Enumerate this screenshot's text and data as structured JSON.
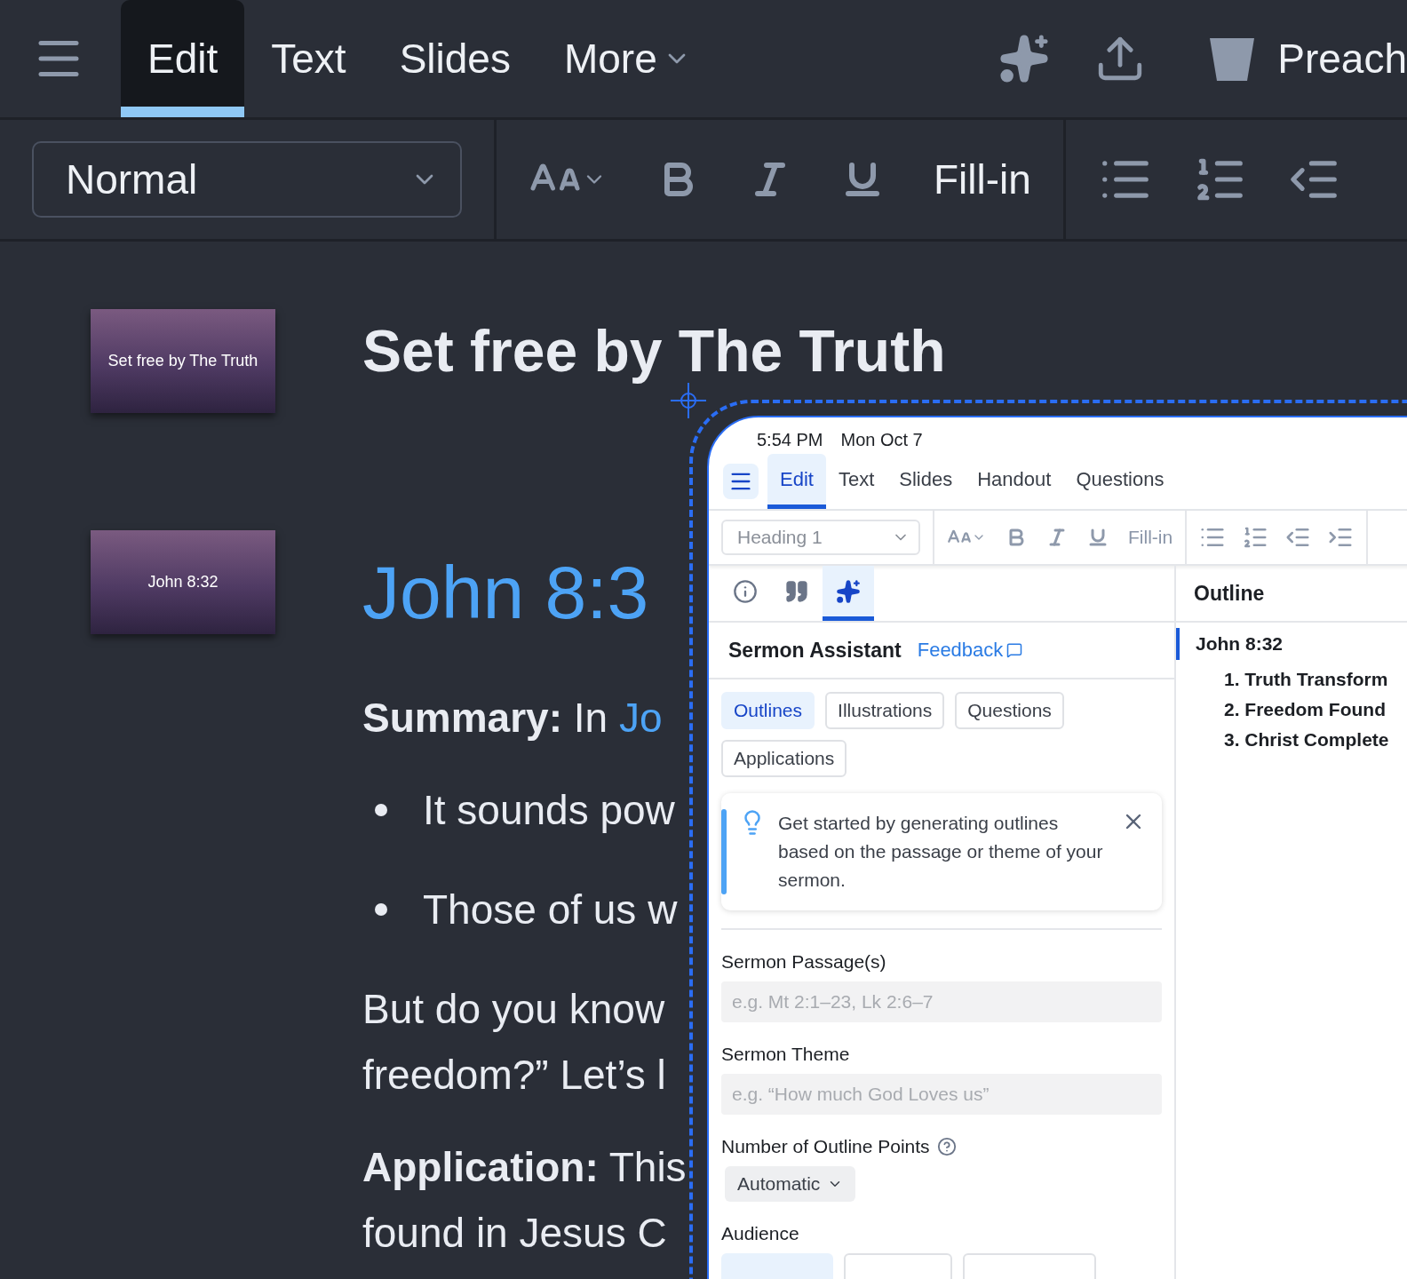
{
  "app_bar": {
    "tabs": [
      {
        "label": "Edit",
        "selected": true
      },
      {
        "label": "Text",
        "selected": false
      },
      {
        "label": "Slides",
        "selected": false
      },
      {
        "label": "More",
        "selected": false,
        "kind": "menu"
      }
    ],
    "account_label": "Preach"
  },
  "format_bar": {
    "style": "Normal",
    "fill_in": "Fill-in"
  },
  "slides": [
    {
      "caption": "Set free by The Truth"
    },
    {
      "caption": "John 8:32"
    }
  ],
  "document": {
    "title": "Set free by The Truth",
    "heading": "John 8:3",
    "blocks": [
      {
        "kind": "labeled",
        "label": "Summary:",
        "text": "In",
        "link": "Jo"
      },
      {
        "kind": "bullet",
        "text": "It sounds pow"
      },
      {
        "kind": "bullet",
        "text": "Those of us w"
      },
      {
        "kind": "paragraph",
        "lines": [
          "But do you know",
          "freedom?” Let’s l"
        ]
      },
      {
        "kind": "labeled",
        "label": "Application:",
        "text": "This",
        "lines": [
          "found in Jesus C"
        ]
      }
    ]
  },
  "inset": {
    "status_time": "5:54 PM",
    "status_date": "Mon Oct 7",
    "tabs": [
      {
        "label": "Edit",
        "selected": true
      },
      {
        "label": "Text",
        "selected": false
      },
      {
        "label": "Slides",
        "selected": false
      },
      {
        "label": "Handout",
        "selected": false
      },
      {
        "label": "Questions",
        "selected": false
      }
    ],
    "style": "Heading 1",
    "fill_in": "Fill-in",
    "panel_tabs": [
      {
        "kind": "info",
        "selected": false
      },
      {
        "kind": "quote",
        "selected": false
      },
      {
        "kind": "sparkle",
        "selected": true
      }
    ],
    "assistant_title": "Sermon Assistant",
    "feedback": "Feedback",
    "modes": [
      {
        "label": "Outlines",
        "selected": true
      },
      {
        "label": "Illustrations",
        "selected": false
      },
      {
        "label": "Questions",
        "selected": false
      },
      {
        "label": "Applications",
        "selected": false
      }
    ],
    "tip": "Get started by generating outlines based on the passage or theme of your sermon.",
    "fields": [
      {
        "label": "Sermon Passage(s)",
        "placeholder": "e.g. Mt 2:1–23, Lk 2:6–7"
      },
      {
        "label": "Sermon Theme",
        "placeholder": "e.g. “How much God Loves us”"
      }
    ],
    "points": {
      "label": "Number of Outline Points",
      "value": "Automatic"
    },
    "audience": {
      "label": "Audience",
      "options": [
        {
          "selected": true
        },
        {
          "selected": false
        },
        {
          "selected": false
        }
      ]
    },
    "outline": {
      "title": "Outline",
      "items": [
        {
          "label": "John 8:32",
          "selected": true,
          "children": [
            {
              "label": "1. Truth Transform"
            },
            {
              "label": "2. Freedom Found"
            },
            {
              "label": "3. Christ Complete"
            }
          ]
        }
      ]
    }
  }
}
